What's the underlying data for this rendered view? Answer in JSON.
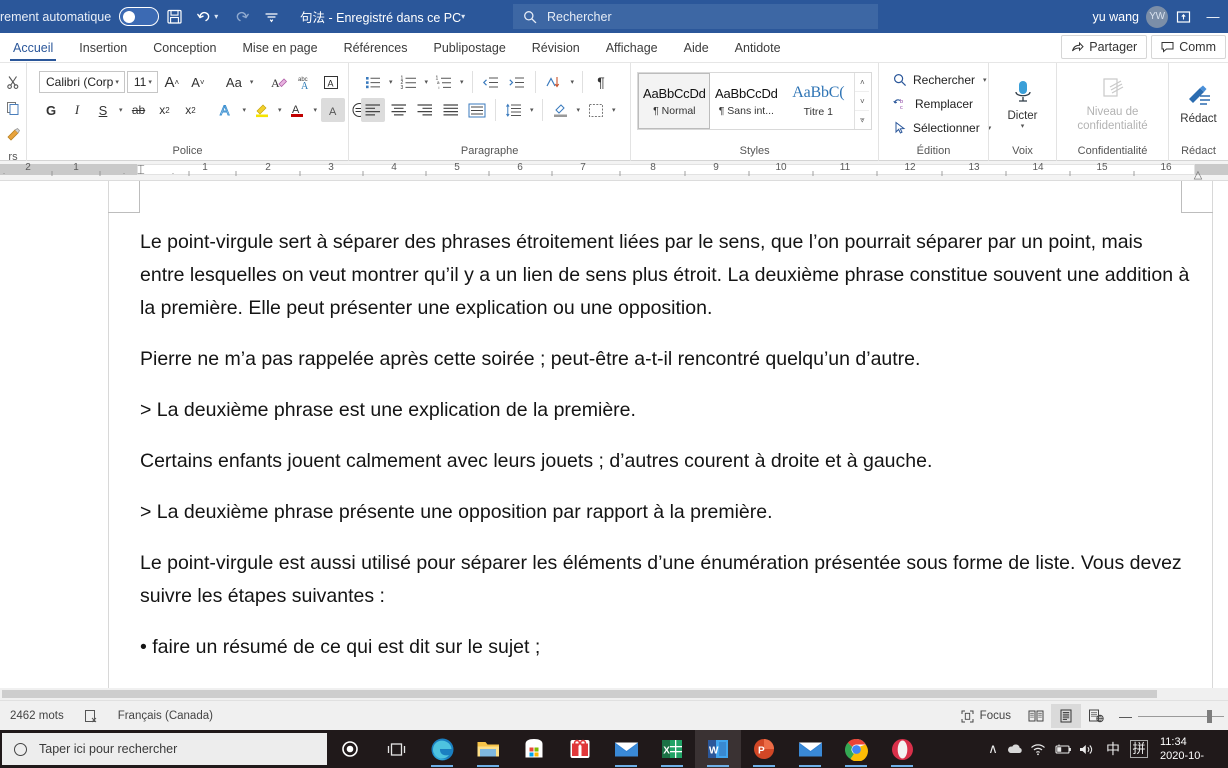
{
  "titlebar": {
    "autosave_label": "rement automatique",
    "autosave_state": "off",
    "document_title": "句法  -  Enregistré dans ce PC",
    "search_placeholder": "Rechercher",
    "user_name": "yu wang",
    "avatar_initials": "YW",
    "minimize_label": "—",
    "accent_color": "#2b579a"
  },
  "tabs": {
    "items": [
      {
        "label": "Accueil",
        "active": true
      },
      {
        "label": "Insertion",
        "active": false
      },
      {
        "label": "Conception",
        "active": false
      },
      {
        "label": "Mise en page",
        "active": false
      },
      {
        "label": "Références",
        "active": false
      },
      {
        "label": "Publipostage",
        "active": false
      },
      {
        "label": "Révision",
        "active": false
      },
      {
        "label": "Affichage",
        "active": false
      },
      {
        "label": "Aide",
        "active": false
      },
      {
        "label": "Antidote",
        "active": false
      }
    ],
    "share_label": "Partager",
    "comments_label": "Comm"
  },
  "ribbon": {
    "clipboard": {
      "group_label": "rs"
    },
    "font": {
      "group_label": "Police",
      "font_name": "Calibri (Corp",
      "font_size": "11",
      "grow_label": "A",
      "shrink_label": "A",
      "case_label": "Aa",
      "clear_label": "A",
      "phonetic_label": "abc",
      "border_label": "A",
      "bold_label": "G",
      "italic_label": "I",
      "underline_label": "S",
      "strike_label": "ab",
      "subscript_label": "x",
      "superscript_label": "x",
      "texteffect_label": "A",
      "highlight_label": "A",
      "fontcolor_label": "A",
      "charshading_label": "A",
      "charborder_label": "A"
    },
    "paragraph": {
      "group_label": "Paragraphe",
      "bullets_label": "•",
      "numbering_label": "1",
      "multilevel_label": "1",
      "decrease_indent_label": "←",
      "increase_indent_label": "→",
      "sort_label": "AZ",
      "show_marks_label": "¶",
      "align_left_label": "≡",
      "align_center_label": "≡",
      "align_right_label": "≡",
      "justify_label": "≡",
      "distribute_label": "≡",
      "line_spacing_label": "↕",
      "shading_label": "▩",
      "borders_label": "▦"
    },
    "styles": {
      "group_label": "Styles",
      "items": [
        {
          "preview": "AaBbCcDd",
          "name": "¶ Normal",
          "selected": true
        },
        {
          "preview": "AaBbCcDd",
          "name": "¶ Sans int...",
          "selected": false
        },
        {
          "preview": "AaBbC(",
          "name": "Titre 1",
          "selected": false
        }
      ]
    },
    "editing": {
      "group_label": "Édition",
      "find_label": "Rechercher",
      "replace_label": "Remplacer",
      "select_label": "Sélectionner"
    },
    "voice": {
      "group_label": "Voix",
      "dictate_label": "Dicter"
    },
    "sensitivity": {
      "group_label": "Confidentialité",
      "button_label": "Niveau de confidentialité",
      "disabled": true
    },
    "editor": {
      "group_label": "Rédact",
      "button_label": "Rédact"
    }
  },
  "ruler": {
    "left_numbers": [
      "2",
      "1"
    ],
    "right_numbers": [
      "1",
      "2",
      "3",
      "4",
      "5",
      "6",
      "7",
      "8",
      "9",
      "10",
      "11",
      "12",
      "13",
      "14",
      "15",
      "16"
    ]
  },
  "document": {
    "paragraphs": [
      " Le point-virgule sert à séparer des phrases étroitement liées par le sens, que l’on pourrait séparer par un point, mais entre lesquelles on veut montrer qu’il y a un lien de sens plus étroit. La deuxième phrase constitue souvent une addition à la première. Elle peut présenter une explication ou une opposition.",
      "Pierre ne m’a pas rappelée après cette soirée ; peut-être a-t-il rencontré quelqu’un d’autre.",
      " > La deuxième phrase est une explication de la première.",
      "Certains enfants jouent calmement avec leurs jouets ; d’autres courent à droite et à gauche.",
      "> La deuxième phrase présente une opposition par rapport à la première.",
      "Le point-virgule est aussi utilisé pour séparer les éléments d’une énumération présentée sous forme de liste. Vous devez suivre les étapes suivantes :",
      "• faire un résumé de ce qui est dit sur le sujet ;"
    ]
  },
  "statusbar": {
    "word_count": "2462 mots",
    "language": "Français (Canada)",
    "focus_label": "Focus",
    "zoom_minus": "—"
  },
  "taskbar": {
    "search_placeholder": "Taper ici pour rechercher",
    "apps": [
      {
        "name": "cortana"
      },
      {
        "name": "task-view"
      },
      {
        "name": "microsoft-edge"
      },
      {
        "name": "file-explorer"
      },
      {
        "name": "microsoft-store"
      },
      {
        "name": "gift-app"
      },
      {
        "name": "mail"
      },
      {
        "name": "excel"
      },
      {
        "name": "word"
      },
      {
        "name": "powerpoint"
      },
      {
        "name": "mail-2"
      },
      {
        "name": "chrome"
      },
      {
        "name": "opera"
      }
    ],
    "ime_label": "中",
    "ime_mode_label": "拼",
    "time": "11:34",
    "date": "2020-10-"
  }
}
